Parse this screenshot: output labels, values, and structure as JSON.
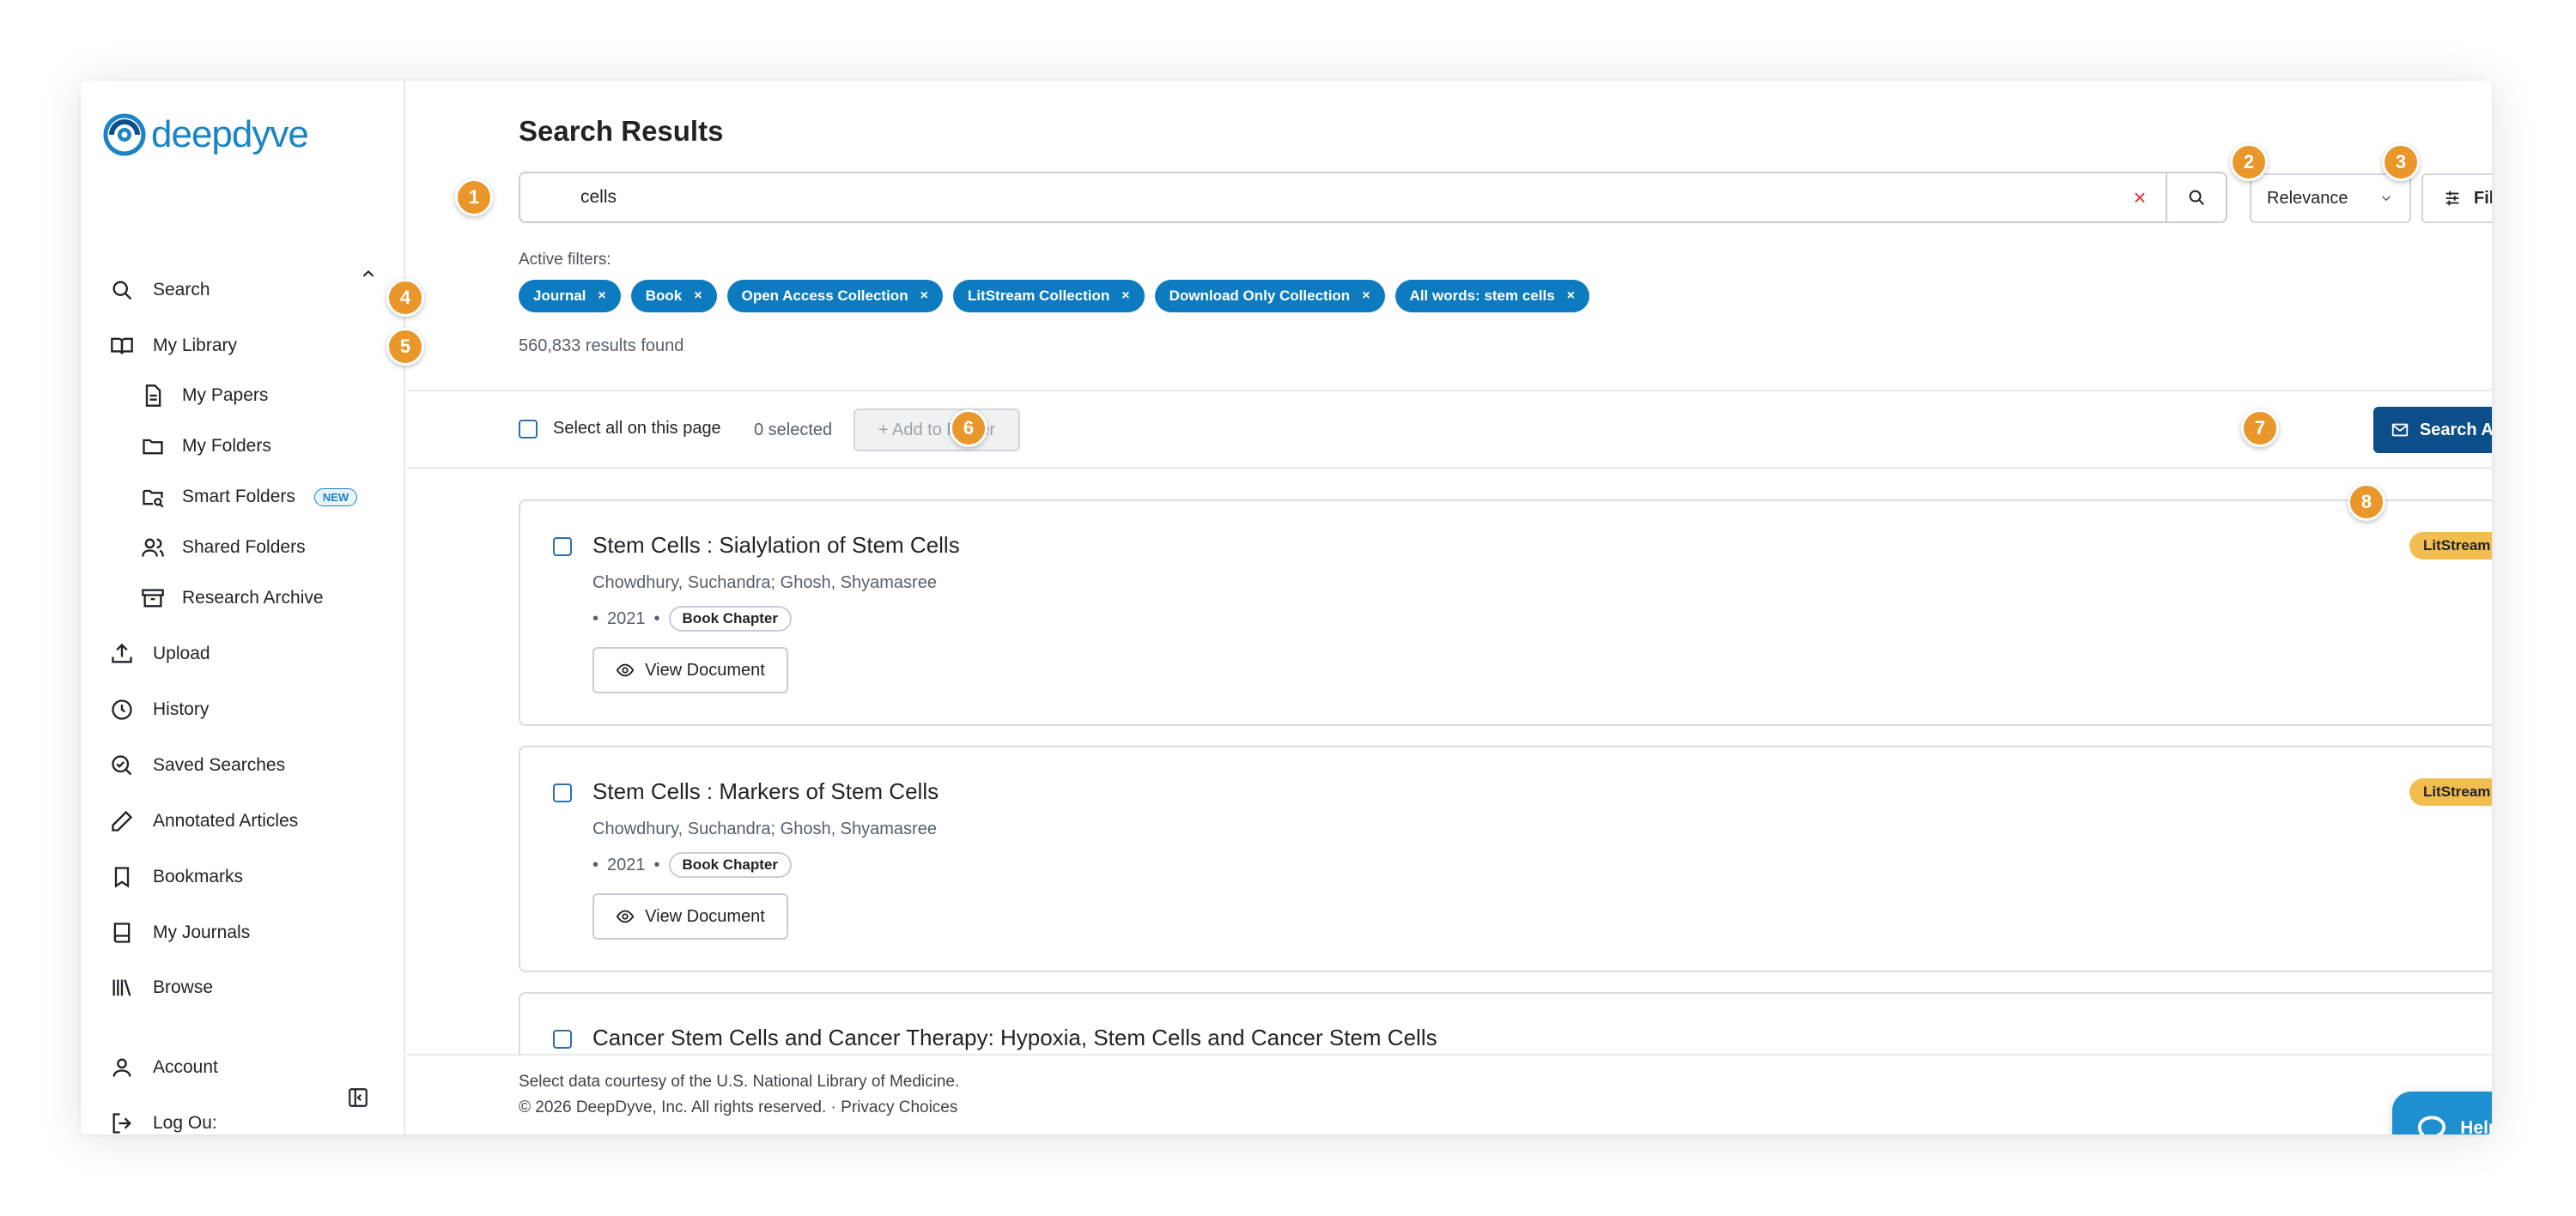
{
  "brand": {
    "name": "deepdyve",
    "logo_color": "#1b84c4"
  },
  "sidebar": {
    "items": [
      {
        "label": "Search",
        "icon": "search-icon"
      },
      {
        "label": "My Library",
        "icon": "book-open-icon"
      },
      {
        "label": "My Papers",
        "icon": "document-icon"
      },
      {
        "label": "My Folders",
        "icon": "folder-icon"
      },
      {
        "label": "Smart Folders",
        "icon": "smart-folder-icon",
        "badge": "NEW"
      },
      {
        "label": "Shared Folders",
        "icon": "users-icon"
      },
      {
        "label": "Research Archive",
        "icon": "archive-icon"
      },
      {
        "label": "Upload",
        "icon": "upload-icon"
      },
      {
        "label": "History",
        "icon": "clock-icon"
      },
      {
        "label": "Saved Searches",
        "icon": "saved-search-icon"
      },
      {
        "label": "Annotated Articles",
        "icon": "pencil-icon"
      },
      {
        "label": "Bookmarks",
        "icon": "bookmark-icon"
      },
      {
        "label": "My Journals",
        "icon": "journal-icon"
      },
      {
        "label": "Browse",
        "icon": "library-icon"
      },
      {
        "label": "Account",
        "icon": "user-icon"
      },
      {
        "label": "Log Ou:",
        "icon": "logout-icon"
      }
    ]
  },
  "main": {
    "title": "Search Results",
    "search": {
      "value": "cells",
      "placeholder": ""
    },
    "sort": {
      "selected": "Relevance"
    },
    "filters_label": "Filters",
    "active_filters_label": "Active filters:",
    "chips": [
      {
        "label": "Journal"
      },
      {
        "label": "Book"
      },
      {
        "label": "Open Access Collection"
      },
      {
        "label": "LitStream Collection"
      },
      {
        "label": "Download Only Collection"
      },
      {
        "label": "All words: stem cells"
      }
    ],
    "chip_remove_glyph": "×",
    "results_count": "560,833 results found"
  },
  "toolbar": {
    "select_all_label": "Select all on this page",
    "selected_count": "0 selected",
    "add_to_folder_label": "+ Add to Folder",
    "search_alerts_label": "Search Alerts"
  },
  "results": [
    {
      "title": "Stem Cells : Sialylation of Stem Cells",
      "authors": "Chowdhury, Suchandra; Ghosh, Shyamasree",
      "year": "2021",
      "type": "Book Chapter",
      "view_label": "View Document",
      "source": "LitStream"
    },
    {
      "title": "Stem Cells : Markers of Stem Cells",
      "authors": "Chowdhury, Suchandra; Ghosh, Shyamasree",
      "year": "2021",
      "type": "Book Chapter",
      "view_label": "View Document",
      "source": "LitStream"
    },
    {
      "title": "Cancer Stem Cells and Cancer Therapy: Hypoxia, Stem Cells and Cancer Stem Cells"
    }
  ],
  "meta_separator": "•",
  "footer": {
    "line1": "Select data courtesy of the U.S. National Library of Medicine.",
    "line2": "© 2026 DeepDyve, Inc. All rights reserved. · Privacy Choices"
  },
  "help": {
    "label": "Help"
  },
  "markers": [
    "1",
    "2",
    "3",
    "4",
    "5",
    "6",
    "7",
    "8"
  ],
  "colors": {
    "chip": "#0d7bbf",
    "primary_button": "#0b4e8a",
    "source_badge": "#f2bd4f",
    "marker": "#e9962b",
    "help": "#1e8fcf",
    "clear_x": "#e0353a"
  }
}
